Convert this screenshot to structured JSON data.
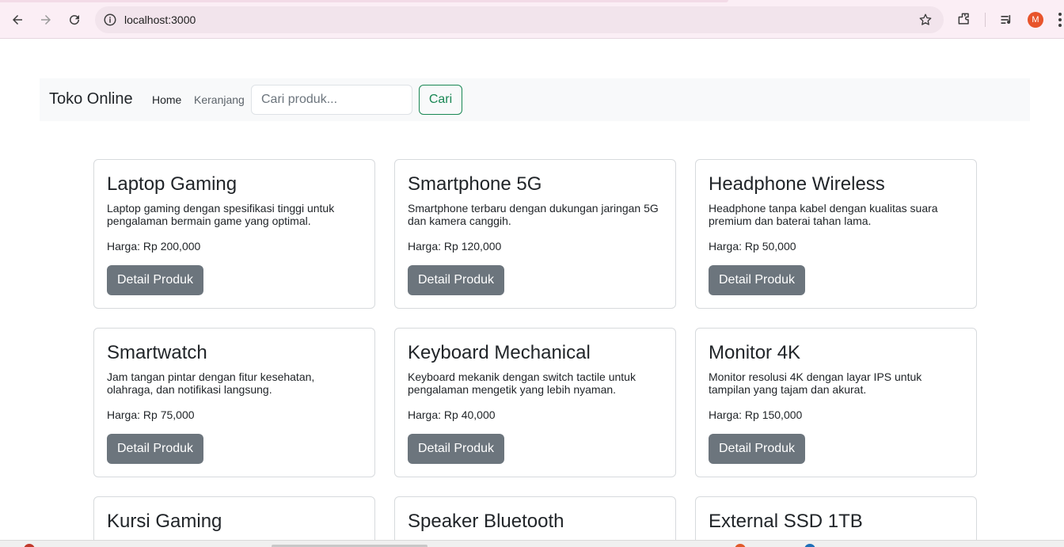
{
  "browser": {
    "url": "localhost:3000",
    "avatar_letter": "M",
    "accent": "#e8542b"
  },
  "navbar": {
    "brand": "Toko Online",
    "links": [
      {
        "label": "Home"
      },
      {
        "label": "Keranjang"
      }
    ],
    "search_placeholder": "Cari produk...",
    "search_button": "Cari"
  },
  "products": [
    {
      "name": "Laptop Gaming",
      "description": "Laptop gaming dengan spesifikasi tinggi untuk pengalaman bermain game yang optimal.",
      "price": "Harga: Rp 200,000",
      "button": "Detail Produk"
    },
    {
      "name": "Smartphone 5G",
      "description": "Smartphone terbaru dengan dukungan jaringan 5G dan kamera canggih.",
      "price": "Harga: Rp 120,000",
      "button": "Detail Produk"
    },
    {
      "name": "Headphone Wireless",
      "description": "Headphone tanpa kabel dengan kualitas suara premium dan baterai tahan lama.",
      "price": "Harga: Rp 50,000",
      "button": "Detail Produk"
    },
    {
      "name": "Smartwatch",
      "description": "Jam tangan pintar dengan fitur kesehatan, olahraga, dan notifikasi langsung.",
      "price": "Harga: Rp 75,000",
      "button": "Detail Produk"
    },
    {
      "name": "Keyboard Mechanical",
      "description": "Keyboard mekanik dengan switch tactile untuk pengalaman mengetik yang lebih nyaman.",
      "price": "Harga: Rp 40,000",
      "button": "Detail Produk"
    },
    {
      "name": "Monitor 4K",
      "description": "Monitor resolusi 4K dengan layar IPS untuk tampilan yang tajam dan akurat.",
      "price": "Harga: Rp 150,000",
      "button": "Detail Produk"
    },
    {
      "name": "Kursi Gaming",
      "description": "",
      "price": "",
      "button": ""
    },
    {
      "name": "Speaker Bluetooth",
      "description": "",
      "price": "",
      "button": ""
    },
    {
      "name": "External SSD 1TB",
      "description": "",
      "price": "",
      "button": ""
    }
  ]
}
